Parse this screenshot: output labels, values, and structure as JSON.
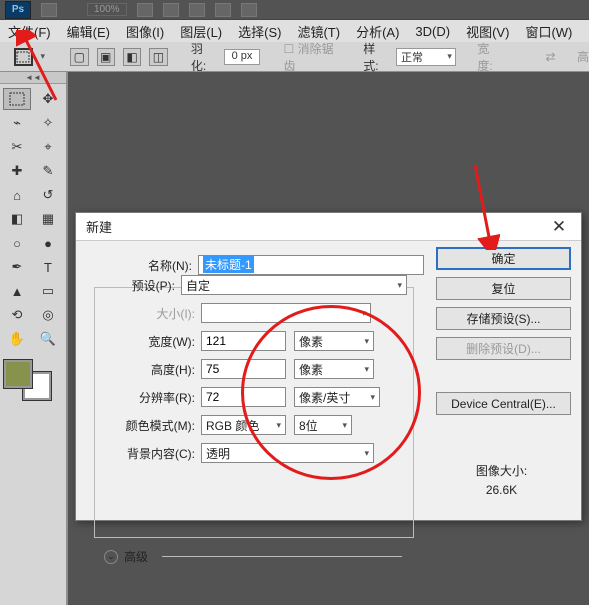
{
  "top": {
    "zoom": "100%"
  },
  "menu": {
    "file": "文件(F)",
    "edit": "编辑(E)",
    "image": "图像(I)",
    "layer": "图层(L)",
    "select": "选择(S)",
    "filter": "滤镜(T)",
    "analysis": "分析(A)",
    "3d": "3D(D)",
    "view": "视图(V)",
    "window": "窗口(W)"
  },
  "opt": {
    "feather_label": "羽化:",
    "feather_val": "0 px",
    "anti_alias": "消除锯齿",
    "style_label": "样式:",
    "style_val": "正常",
    "width_label": "宽度:",
    "height_label": "高"
  },
  "dialog": {
    "title": "新建",
    "name_label": "名称(N):",
    "name_value": "未标题-1",
    "preset_label": "预设(P):",
    "preset_value": "自定",
    "size_label": "大小(I):",
    "width_label": "宽度(W):",
    "width_value": "121",
    "width_unit": "像素",
    "height_label": "高度(H):",
    "height_value": "75",
    "height_unit": "像素",
    "res_label": "分辨率(R):",
    "res_value": "72",
    "res_unit": "像素/英寸",
    "mode_label": "颜色模式(M):",
    "mode_value": "RGB 颜色",
    "mode_bits": "8位",
    "bg_label": "背景内容(C):",
    "bg_value": "透明",
    "advanced": "高级",
    "btn_ok": "确定",
    "btn_reset": "复位",
    "btn_save_preset": "存储预设(S)...",
    "btn_del_preset": "删除预设(D)...",
    "btn_dc": "Device Central(E)...",
    "imgsize_label": "图像大小:",
    "imgsize_value": "26.6K"
  }
}
